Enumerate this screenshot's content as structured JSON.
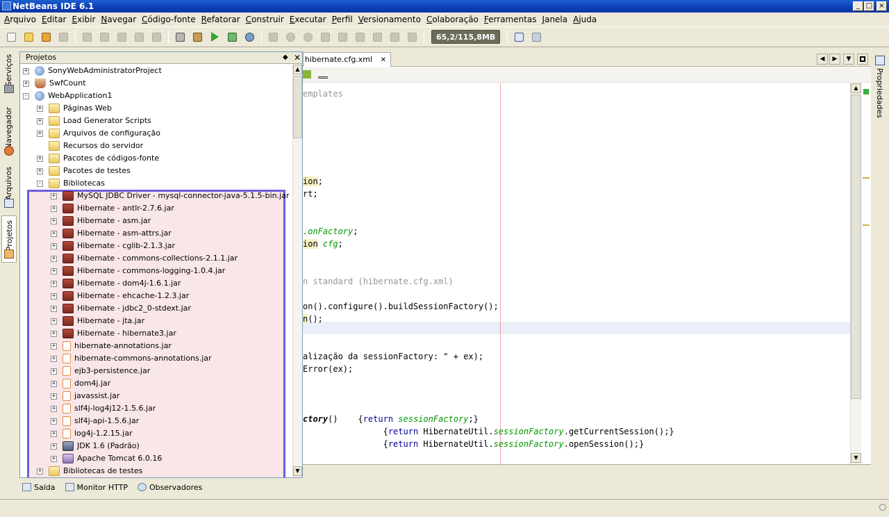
{
  "window": {
    "title": "NetBeans IDE 6.1",
    "controls": [
      "_",
      "□",
      "×"
    ]
  },
  "menu": [
    "Arquivo",
    "Editar",
    "Exibir",
    "Navegar",
    "Código-fonte",
    "Refatorar",
    "Construir",
    "Executar",
    "Perfil",
    "Versionamento",
    "Colaboração",
    "Ferramentas",
    "Janela",
    "Ajuda"
  ],
  "toolbar": {
    "memory": "65,2/115,8MB"
  },
  "left_strip": [
    "Serviços",
    "Navegador",
    "Arquivos",
    "Projetos"
  ],
  "right_strip": [
    "Propriedades"
  ],
  "projects": {
    "title": "Projetos",
    "tree": [
      {
        "label": "SonyWebAdministratorProject",
        "level": 0,
        "icon": "globe-icon",
        "exp": "+"
      },
      {
        "label": "SwfCount",
        "level": 0,
        "icon": "cup-icon",
        "exp": "+"
      },
      {
        "label": "WebApplication1",
        "level": 0,
        "icon": "globe-icon",
        "exp": "-"
      },
      {
        "label": "Páginas Web",
        "level": 1,
        "icon": "folder-icon",
        "exp": "+"
      },
      {
        "label": "Load Generator Scripts",
        "level": 1,
        "icon": "folder-icon",
        "exp": "+"
      },
      {
        "label": "Arquivos de configuração",
        "level": 1,
        "icon": "folder-icon",
        "exp": "+"
      },
      {
        "label": "Recursos do servidor",
        "level": 1,
        "icon": "folder-icon",
        "exp": ""
      },
      {
        "label": "Pacotes de códigos-fonte",
        "level": 1,
        "icon": "folder-icon",
        "exp": "+"
      },
      {
        "label": "Pacotes de testes",
        "level": 1,
        "icon": "folder-icon",
        "exp": "+"
      },
      {
        "label": "Bibliotecas",
        "level": 1,
        "icon": "folder-icon",
        "exp": "-"
      },
      {
        "label": "MySQL JDBC Driver - mysql-connector-java-5.1.5-bin.jar",
        "level": 2,
        "icon": "jar-icon",
        "exp": "+"
      },
      {
        "label": "Hibernate - antlr-2.7.6.jar",
        "level": 2,
        "icon": "jar-icon",
        "exp": "+"
      },
      {
        "label": "Hibernate - asm.jar",
        "level": 2,
        "icon": "jar-icon",
        "exp": "+"
      },
      {
        "label": "Hibernate - asm-attrs.jar",
        "level": 2,
        "icon": "jar-icon",
        "exp": "+"
      },
      {
        "label": "Hibernate - cglib-2.1.3.jar",
        "level": 2,
        "icon": "jar-icon",
        "exp": "+"
      },
      {
        "label": "Hibernate - commons-collections-2.1.1.jar",
        "level": 2,
        "icon": "jar-icon",
        "exp": "+"
      },
      {
        "label": "Hibernate - commons-logging-1.0.4.jar",
        "level": 2,
        "icon": "jar-icon",
        "exp": "+"
      },
      {
        "label": "Hibernate - dom4j-1.6.1.jar",
        "level": 2,
        "icon": "jar-icon",
        "exp": "+"
      },
      {
        "label": "Hibernate - ehcache-1.2.3.jar",
        "level": 2,
        "icon": "jar-icon",
        "exp": "+"
      },
      {
        "label": "Hibernate - jdbc2_0-stdext.jar",
        "level": 2,
        "icon": "jar-icon",
        "exp": "+"
      },
      {
        "label": "Hibernate - jta.jar",
        "level": 2,
        "icon": "jar-icon",
        "exp": "+"
      },
      {
        "label": "Hibernate - hibernate3.jar",
        "level": 2,
        "icon": "jar-icon",
        "exp": "+"
      },
      {
        "label": "hibernate-annotations.jar",
        "level": 2,
        "icon": "jar-file-icon",
        "exp": "+"
      },
      {
        "label": "hibernate-commons-annotations.jar",
        "level": 2,
        "icon": "jar-file-icon",
        "exp": "+"
      },
      {
        "label": "ejb3-persistence.jar",
        "level": 2,
        "icon": "jar-file-icon",
        "exp": "+"
      },
      {
        "label": "dom4j.jar",
        "level": 2,
        "icon": "jar-file-icon",
        "exp": "+"
      },
      {
        "label": "javassist.jar",
        "level": 2,
        "icon": "jar-file-icon",
        "exp": "+"
      },
      {
        "label": "slf4j-log4j12-1.5.6.jar",
        "level": 2,
        "icon": "jar-file-icon",
        "exp": "+"
      },
      {
        "label": "slf4j-api-1.5.6.jar",
        "level": 2,
        "icon": "jar-file-icon",
        "exp": "+"
      },
      {
        "label": "log4j-1.2.15.jar",
        "level": 2,
        "icon": "jar-file-icon",
        "exp": "+"
      },
      {
        "label": "JDK 1.6 (Padrão)",
        "level": 2,
        "icon": "jdk-icon",
        "exp": "+"
      },
      {
        "label": "Apache Tomcat 6.0.16",
        "level": 2,
        "icon": "tomcat-icon",
        "exp": "+"
      },
      {
        "label": "Bibliotecas de testes",
        "level": 1,
        "icon": "folder-icon",
        "exp": "+"
      }
    ]
  },
  "editor": {
    "tab": "hibernate.cfg.xml",
    "lines": [
      {
        "row": 1,
        "parts": [
          {
            "t": "emplates",
            "c": "cm"
          }
        ]
      },
      {
        "row": 8,
        "parts": [
          {
            "t": "ion",
            "c": "hl"
          },
          {
            "t": ";",
            "c": ""
          }
        ]
      },
      {
        "row": 9,
        "parts": [
          {
            "t": "rt;",
            "c": ""
          }
        ]
      },
      {
        "row": 12,
        "parts": [
          {
            "t": ".onFactory",
            "c": "it"
          },
          {
            "t": ";",
            "c": ""
          }
        ]
      },
      {
        "row": 13,
        "parts": [
          {
            "t": "ion",
            "c": "hl"
          },
          {
            "t": " ",
            "c": ""
          },
          {
            "t": "cfg",
            "c": "it"
          },
          {
            "t": ";",
            "c": ""
          }
        ]
      },
      {
        "row": 16,
        "parts": [
          {
            "t": "n standard (hibernate.cfg.xml)",
            "c": "cm"
          }
        ]
      },
      {
        "row": 18,
        "parts": [
          {
            "t": "on().configure().buildSessionFactory();",
            "c": ""
          }
        ]
      },
      {
        "row": 19,
        "parts": [
          {
            "t": "n",
            "c": "hl"
          },
          {
            "t": "();",
            "c": ""
          }
        ]
      },
      {
        "row": 22,
        "parts": [
          {
            "t": "alização da sessionFactory: \" + ex);",
            "c": ""
          }
        ]
      },
      {
        "row": 23,
        "parts": [
          {
            "t": "Error(ex);",
            "c": ""
          }
        ]
      },
      {
        "row": 27,
        "parts": [
          {
            "t": "ctory",
            "c": "b"
          },
          {
            "t": "()    {",
            "c": ""
          },
          {
            "t": "return",
            "c": "kw"
          },
          {
            "t": " ",
            "c": ""
          },
          {
            "t": "sessionFactory",
            "c": "it"
          },
          {
            "t": ";}",
            "c": ""
          }
        ]
      },
      {
        "row": 28,
        "parts": [
          {
            "t": "                {",
            "c": ""
          },
          {
            "t": "return",
            "c": "kw"
          },
          {
            "t": " HibernateUtil.",
            "c": ""
          },
          {
            "t": "sessionFactory",
            "c": "it"
          },
          {
            "t": ".getCurrentSession();}",
            "c": ""
          }
        ]
      },
      {
        "row": 29,
        "parts": [
          {
            "t": "                {",
            "c": ""
          },
          {
            "t": "return",
            "c": "kw"
          },
          {
            "t": " HibernateUtil.",
            "c": ""
          },
          {
            "t": "sessionFactory",
            "c": "it"
          },
          {
            "t": ".openSession();}",
            "c": ""
          }
        ]
      }
    ]
  },
  "bottom_tabs": [
    "Saída",
    "Monitor HTTP",
    "Observadores"
  ]
}
